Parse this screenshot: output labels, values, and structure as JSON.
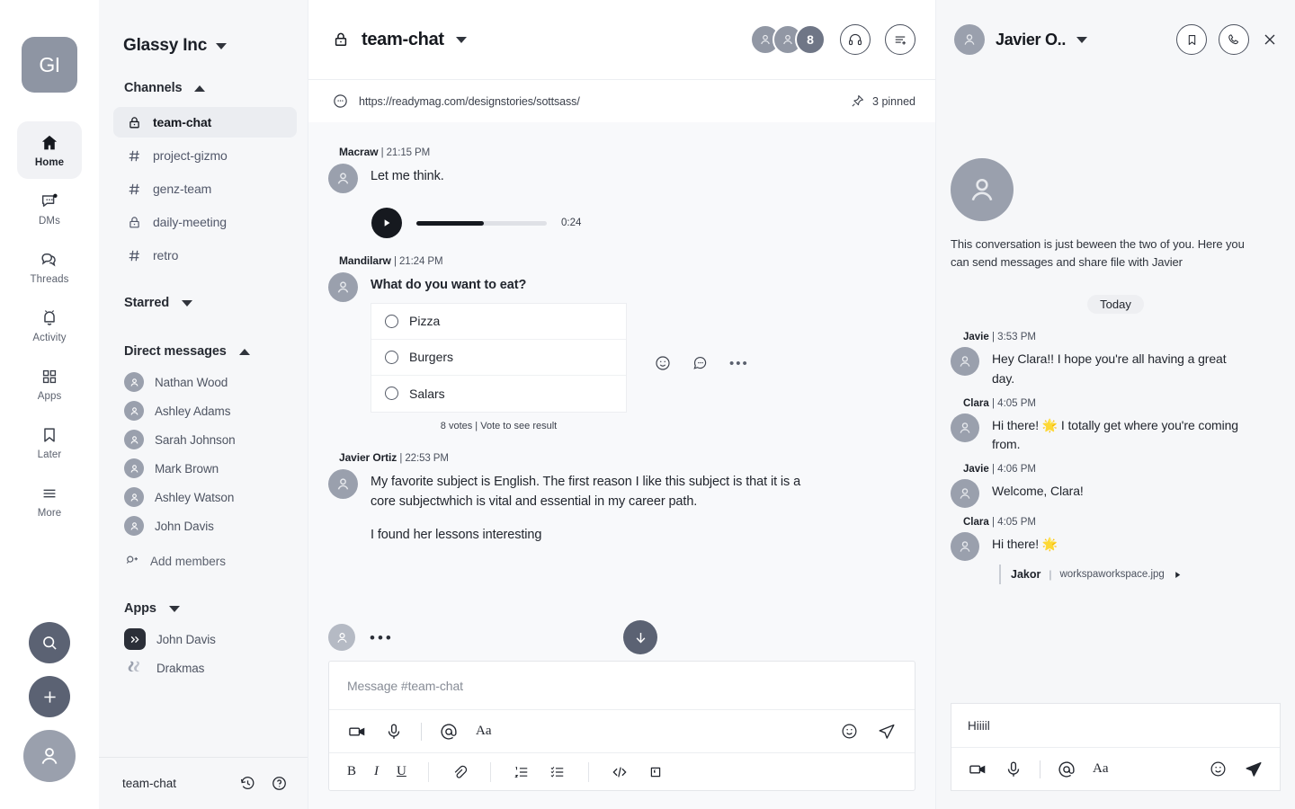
{
  "rail": {
    "workspace_initials": "GI",
    "items": [
      {
        "label": "Home",
        "icon": "home-icon",
        "active": true
      },
      {
        "label": "DMs",
        "icon": "dms-icon",
        "active": false
      },
      {
        "label": "Threads",
        "icon": "threads-icon",
        "active": false
      },
      {
        "label": "Activity",
        "icon": "bell-icon",
        "active": false
      },
      {
        "label": "Apps",
        "icon": "apps-grid-icon",
        "active": false
      },
      {
        "label": "Later",
        "icon": "bookmark-icon",
        "active": false
      },
      {
        "label": "More",
        "icon": "hamburger-icon",
        "active": false
      }
    ],
    "bottom": [
      {
        "name": "search-button",
        "icon": "search-icon"
      },
      {
        "name": "new-button",
        "icon": "plus-icon"
      },
      {
        "name": "profile-avatar",
        "icon": "user-icon"
      }
    ]
  },
  "sidebar": {
    "workspace_name": "Glassy Inc",
    "sections": {
      "channels": {
        "title": "Channels",
        "expanded": true
      },
      "starred": {
        "title": "Starred",
        "expanded": false
      },
      "direct_messages": {
        "title": "Direct messages",
        "expanded": true
      },
      "apps": {
        "title": "Apps",
        "expanded": false
      }
    },
    "channels": [
      {
        "name": "team-chat",
        "icon": "lock-icon",
        "active": true
      },
      {
        "name": "project-gizmo",
        "icon": "hash-icon",
        "active": false
      },
      {
        "name": "genz-team",
        "icon": "hash-icon",
        "active": false
      },
      {
        "name": "daily-meeting",
        "icon": "lock-icon",
        "active": false
      },
      {
        "name": "retro",
        "icon": "hash-icon",
        "active": false
      }
    ],
    "direct_messages": [
      {
        "name": "Nathan Wood"
      },
      {
        "name": "Ashley Adams"
      },
      {
        "name": "Sarah Johnson"
      },
      {
        "name": "Mark Brown"
      },
      {
        "name": "Ashley Watson"
      },
      {
        "name": "John Davis"
      }
    ],
    "add_members_label": "Add members",
    "apps": [
      {
        "name": "John Davis",
        "icon": "chevrons-app-icon"
      },
      {
        "name": "Drakmas",
        "icon": "drakmas-app-icon"
      }
    ],
    "footer": {
      "channel": "team-chat",
      "icons": [
        "history-icon",
        "help-icon"
      ]
    }
  },
  "channel": {
    "title": "team-chat",
    "privacy_icon": "lock-icon",
    "member_count": "8",
    "header_actions": [
      "headphones-icon",
      "list-add-icon"
    ],
    "topic_link": "https://readymag.com/designstories/sottsass/",
    "pinned_label": "3 pinned",
    "messages": [
      {
        "author": "Macraw",
        "time": "21:15 PM",
        "text": "Let me think.",
        "audio": {
          "duration": "0:24",
          "progress_percent": 52
        }
      },
      {
        "author": "Mandilarw",
        "time": "21:24 PM",
        "text": "What do you want to eat?",
        "poll": {
          "options": [
            "Pizza",
            "Burgers",
            "Salars"
          ],
          "footer": "8 votes | Vote to see result"
        },
        "reactions": [
          "emoji-icon",
          "reply-icon",
          "more-icon"
        ]
      },
      {
        "author": "Javier Ortiz",
        "time": "22:53 PM",
        "paragraphs": [
          "My favorite subject is English. The first reason I like this subject is that it is a core subjectwhich is vital and essential in my career path.",
          "I found her lessons interesting"
        ]
      }
    ],
    "typing_indicator": "•••",
    "composer": {
      "placeholder": "Message #team-chat",
      "toolbar": [
        "video-icon",
        "mic-icon",
        "mention-icon",
        "font-icon"
      ],
      "font_label": "Aa",
      "right_toolbar": [
        "emoji-icon",
        "send-icon"
      ],
      "format_toolbar": [
        "bold-icon",
        "italic-icon",
        "underline-icon",
        "link-icon",
        "ordered-list-icon",
        "checklist-icon",
        "code-icon",
        "blockquote-icon"
      ],
      "bold_label": "B",
      "italic_label": "I",
      "underline_label": "U"
    }
  },
  "right_panel": {
    "user_name": "Javier O..",
    "actions": [
      "bookmark-icon",
      "call-icon",
      "close-icon"
    ],
    "intro_text": "This conversation is just beween the two of you. Here you can send messages and share file with Javier",
    "date_divider": "Today",
    "messages": [
      {
        "author": "Javie",
        "time": "3:53 PM",
        "text": "Hey Clara!! I hope you're all having a great day."
      },
      {
        "author": "Clara",
        "time": "4:05 PM",
        "text": "Hi there! 🌟 I totally get where you're coming from."
      },
      {
        "author": "Javie",
        "time": "4:06 PM",
        "text": "Welcome, Clara!"
      },
      {
        "author": "Clara",
        "time": "4:05 PM",
        "text": "Hi there! 🌟",
        "attachment": {
          "author": "Jakor",
          "filename": "workspaworkspace.jpg"
        }
      }
    ],
    "composer": {
      "value": "Hiiiil",
      "toolbar": [
        "video-icon",
        "mic-icon",
        "mention-icon",
        "font-icon"
      ],
      "font_label": "Aa",
      "right_toolbar": [
        "emoji-icon",
        "send-icon"
      ]
    }
  },
  "colors": {
    "rail_bg": "#ffffff",
    "sidebar_bg": "#f6f7f9",
    "main_bg": "#f8f9fb",
    "accent_dark": "#5b6273",
    "avatar_gray": "#9aa0ad",
    "logo_bg": "#8e95a3"
  }
}
